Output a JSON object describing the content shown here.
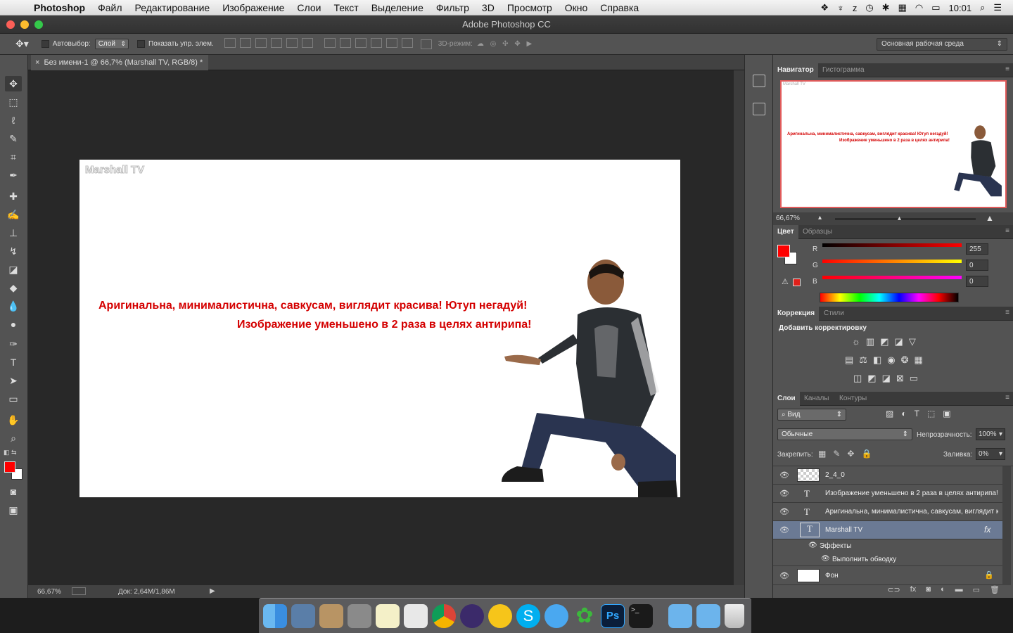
{
  "menubar": {
    "app_name": "Photoshop",
    "items": [
      "Файл",
      "Редактирование",
      "Изображение",
      "Слои",
      "Текст",
      "Выделение",
      "Фильтр",
      "3D",
      "Просмотр",
      "Окно",
      "Справка"
    ],
    "clock": "10:01"
  },
  "window": {
    "title": "Adobe Photoshop CC"
  },
  "options": {
    "autoselect_label": "Автовыбор:",
    "autoselect_value": "Слой",
    "show_controls_label": "Показать упр. элем.",
    "mode3d_label": "3D-режим:",
    "workspace": "Основная рабочая среда"
  },
  "document": {
    "tab_title": "Без имени-1 @ 66,7% (Marshall TV, RGB/8) *",
    "watermark": "Marshall TV",
    "line1": "Аригинальна, минималистична, савкусам, виглядит красива! Ютуп негадуй!",
    "line2": "Изображение уменьшено в 2 раза в целях антирипа!"
  },
  "status": {
    "zoom": "66,67%",
    "doc": "Док: 2,64M/1,86M"
  },
  "navigator": {
    "tabs": [
      "Навигатор",
      "Гистограмма"
    ],
    "zoom": "66,67%",
    "preview_text1": "Аригинальна, минималистична, савкусам, виглядит красива! Ютуп негадуй!",
    "preview_text2": "Изображение уменьшено в 2 раза в целях антирипа!",
    "preview_mark": "Marshall TV"
  },
  "color": {
    "tabs": [
      "Цвет",
      "Образцы"
    ],
    "r_label": "R",
    "g_label": "G",
    "b_label": "B",
    "r": "255",
    "g": "0",
    "b": "0",
    "foreground": "#ff0000",
    "background": "#ffffff"
  },
  "adjustments": {
    "tabs": [
      "Коррекция",
      "Стили"
    ],
    "title": "Добавить корректировку"
  },
  "layers": {
    "tabs": [
      "Слои",
      "Каналы",
      "Контуры"
    ],
    "filter": "Вид",
    "blend": "Обычные",
    "opacity_label": "Непрозрачность:",
    "opacity": "100%",
    "lock_label": "Закрепить:",
    "fill_label": "Заливка:",
    "fill": "0%",
    "items": [
      {
        "name": "2_4_0"
      },
      {
        "name": "Изображение уменьшено в 2 раза в целях антирипа!"
      },
      {
        "name": "Аригинальна, минималистична, савкусам, виглядит краси..."
      },
      {
        "name": "Marshall TV"
      },
      {
        "name": "Эффекты"
      },
      {
        "name": "Выполнить обводку"
      },
      {
        "name": "Фон"
      }
    ]
  }
}
